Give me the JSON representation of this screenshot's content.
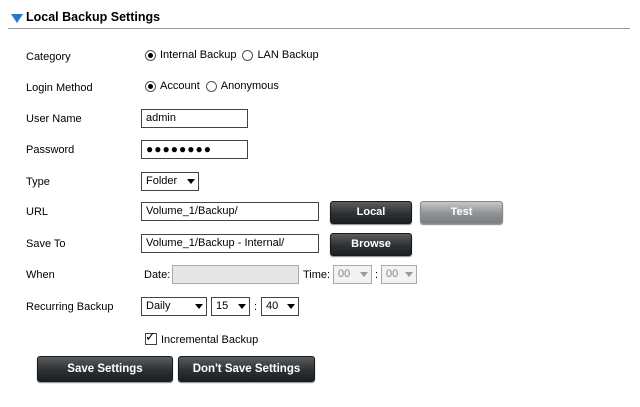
{
  "section": {
    "title": "Local Backup Settings"
  },
  "category": {
    "label": "Category",
    "options": [
      "Internal Backup",
      "LAN Backup"
    ],
    "selected": "Internal Backup"
  },
  "login_method": {
    "label": "Login Method",
    "options": [
      "Account",
      "Anonymous"
    ],
    "selected": "Account"
  },
  "user_name": {
    "label": "User Name",
    "value": "admin"
  },
  "password": {
    "label": "Password",
    "value": "●●●●●●●●"
  },
  "type": {
    "label": "Type",
    "value": "Folder"
  },
  "url": {
    "label": "URL",
    "value": "Volume_1/Backup/",
    "local_button": "Local",
    "test_button": "Test"
  },
  "save_to": {
    "label": "Save To",
    "value": "Volume_1/Backup - Internal/",
    "browse_button": "Browse"
  },
  "when": {
    "label": "When",
    "date_label": "Date:",
    "date_value": "",
    "time_label": "Time:",
    "hour": "00",
    "minute": "00",
    "colon": ":"
  },
  "recurring": {
    "label": "Recurring Backup",
    "frequency": "Daily",
    "hour": "15",
    "minute": "40",
    "colon": ":"
  },
  "incremental": {
    "label": "Incremental Backup",
    "checked": true
  },
  "actions": {
    "save": "Save Settings",
    "dont_save": "Don't Save Settings"
  }
}
